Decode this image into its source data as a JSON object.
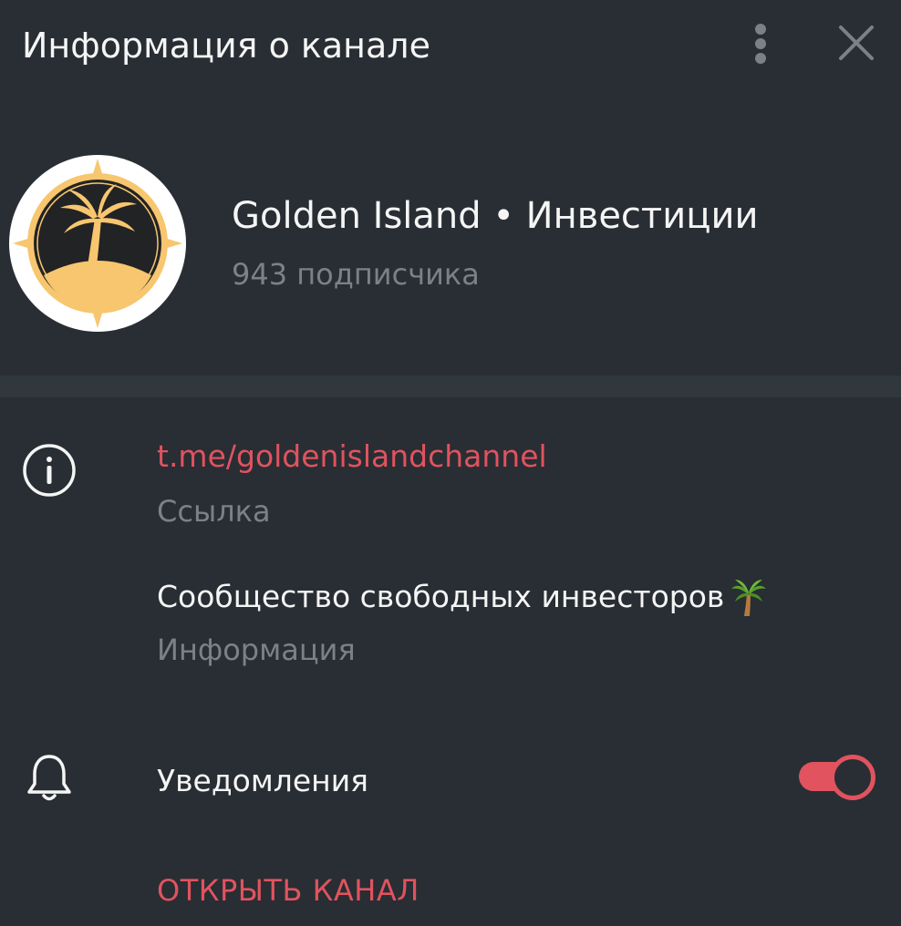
{
  "header": {
    "title": "Информация о канале",
    "menu_icon": "more-vertical-icon",
    "close_icon": "close-icon"
  },
  "channel": {
    "name": "Golden Island • Инвестиции",
    "subscribers": "943 подписчика",
    "avatar_icon": "palm-island-logo"
  },
  "info": {
    "link": "t.me/goldenislandchannel",
    "link_label": "Ссылка",
    "description": "Сообщество свободных инвесторов",
    "description_emoji": "palm-tree-emoji",
    "description_label": "Информация"
  },
  "notifications": {
    "label": "Уведомления",
    "enabled": true
  },
  "actions": {
    "open_channel": "ОТКРЫТЬ КАНАЛ"
  },
  "colors": {
    "background": "#282e33",
    "divider": "#30373d",
    "accent": "#e0535f",
    "secondary_text": "#7b8186",
    "primary_text": "#f5f5f5",
    "logo_gold": "#f7c66f",
    "logo_dark": "#222325"
  }
}
